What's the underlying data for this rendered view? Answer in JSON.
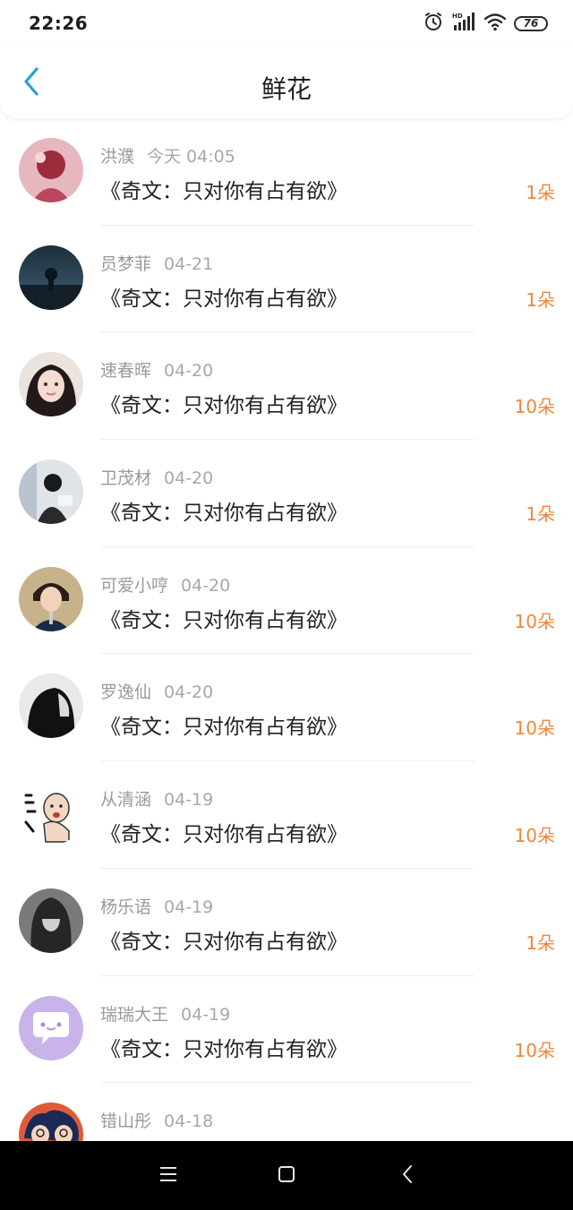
{
  "status_bar": {
    "time": "22:26",
    "battery": "76",
    "icons": [
      "alarm-icon",
      "hd-signal-icon",
      "wifi-icon",
      "battery-icon"
    ]
  },
  "header": {
    "title": "鲜花",
    "back_icon": "chevron-left-icon"
  },
  "colors": {
    "accent_back": "#2d9cdb",
    "flower_count": "#f0863a",
    "meta_gray": "#9a9a9a"
  },
  "items": [
    {
      "name": "洪濮",
      "date": "今天 04:05",
      "book": "《奇文：只对你有占有欲》",
      "count": "1朵"
    },
    {
      "name": "员梦菲",
      "date": "04-21",
      "book": "《奇文：只对你有占有欲》",
      "count": "1朵"
    },
    {
      "name": "速春晖",
      "date": "04-20",
      "book": "《奇文：只对你有占有欲》",
      "count": "10朵"
    },
    {
      "name": "卫茂材",
      "date": "04-20",
      "book": "《奇文：只对你有占有欲》",
      "count": "1朵"
    },
    {
      "name": "可爱小哼",
      "date": "04-20",
      "book": "《奇文：只对你有占有欲》",
      "count": "10朵"
    },
    {
      "name": "罗逸仙",
      "date": "04-20",
      "book": "《奇文：只对你有占有欲》",
      "count": "10朵"
    },
    {
      "name": "从清涵",
      "date": "04-19",
      "book": "《奇文：只对你有占有欲》",
      "count": "10朵"
    },
    {
      "name": "杨乐语",
      "date": "04-19",
      "book": "《奇文：只对你有占有欲》",
      "count": "1朵"
    },
    {
      "name": "瑞瑞大王",
      "date": "04-19",
      "book": "《奇文：只对你有占有欲》",
      "count": "10朵"
    },
    {
      "name": "错山彤",
      "date": "04-18",
      "book": "",
      "count": ""
    }
  ],
  "nav_bar": {
    "buttons": [
      "menu-icon",
      "home-square-icon",
      "back-triangle-icon"
    ]
  }
}
